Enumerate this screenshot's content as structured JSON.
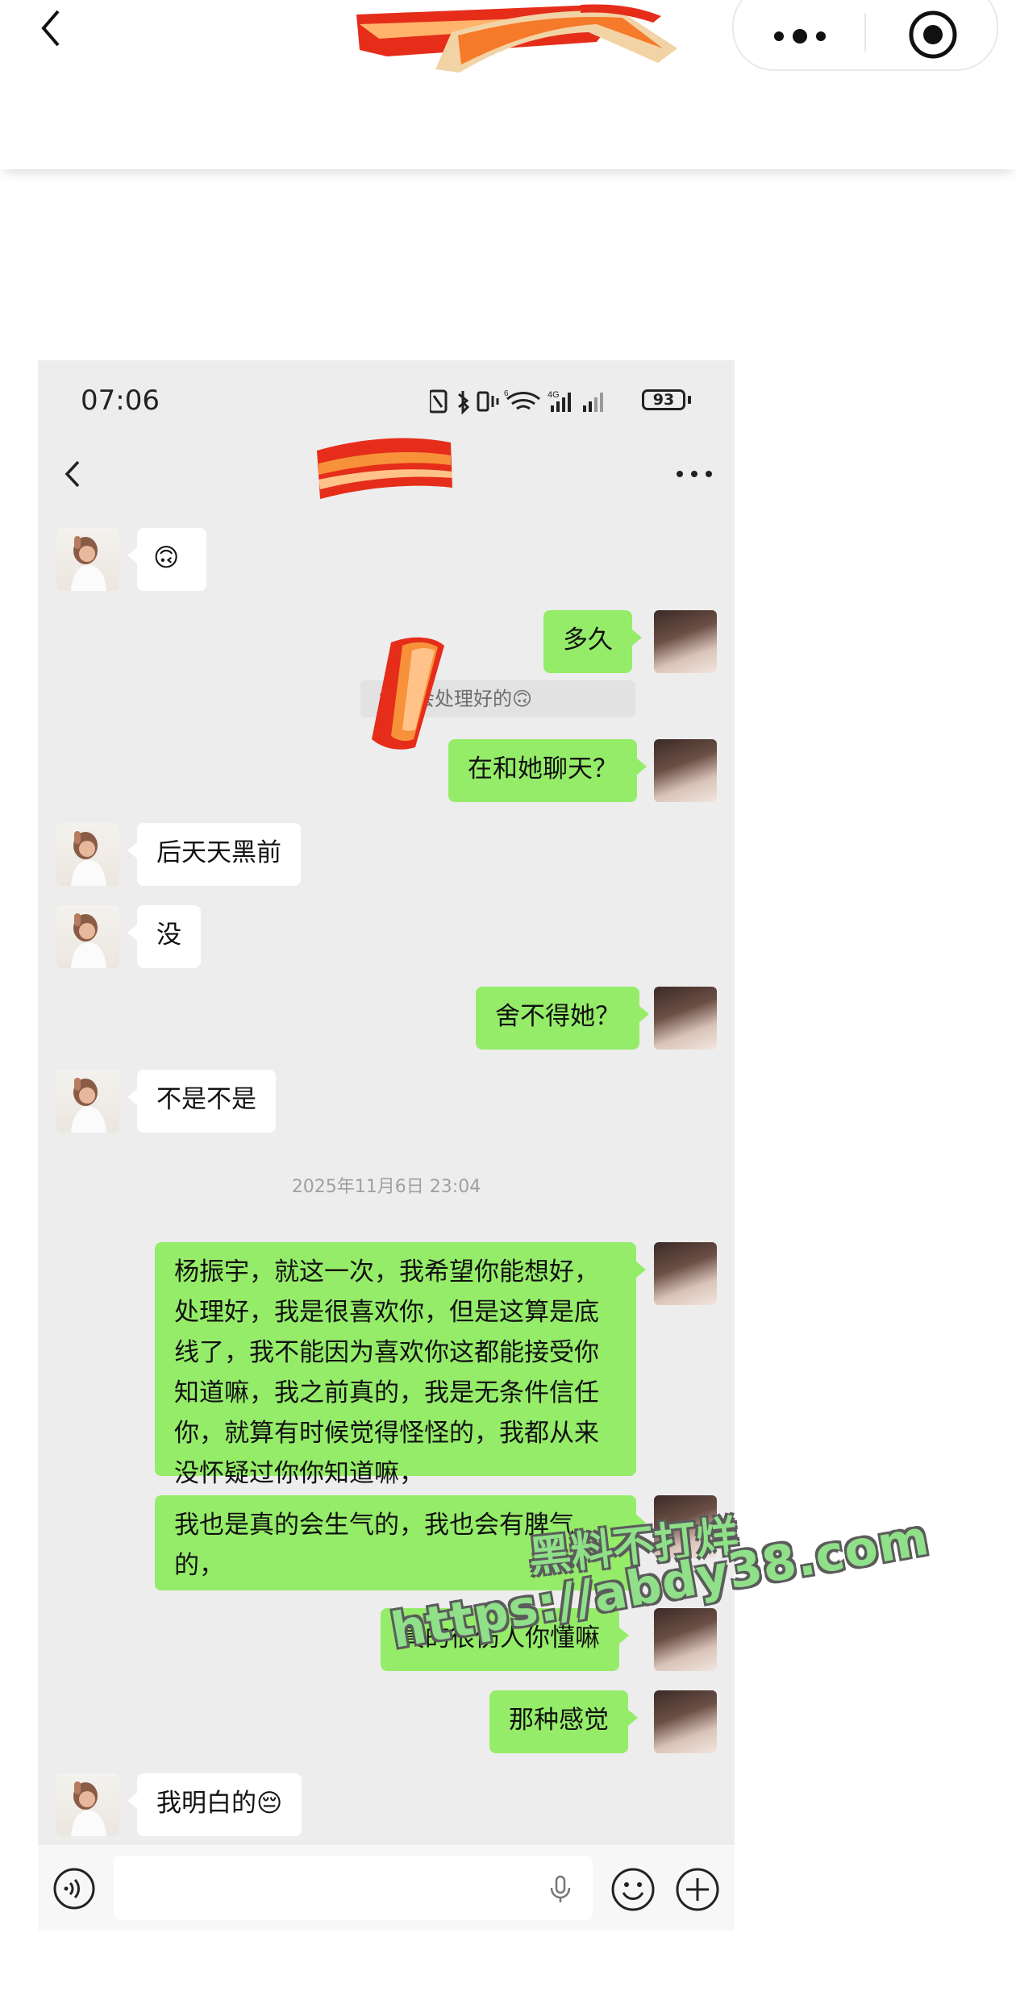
{
  "status_bar": {
    "time": "07:06",
    "battery": "93"
  },
  "timestamp": "2025年11月6日 23:04",
  "quote": {
    "text": "：我会处理好的🙃"
  },
  "messages": [
    {
      "side": "left",
      "text": "🙃"
    },
    {
      "side": "right",
      "text": "多久"
    },
    {
      "side": "right",
      "text": "在和她聊天？"
    },
    {
      "side": "left",
      "text": "后天天黑前"
    },
    {
      "side": "left",
      "text": "没"
    },
    {
      "side": "right",
      "text": "舍不得她？"
    },
    {
      "side": "left",
      "text": "不是不是"
    },
    {
      "side": "right",
      "text": "杨振宇，就这一次，我希望你能想好，处理好，我是很喜欢你，但是这算是底线了，我不能因为喜欢你这都能接受你知道嘛，我之前真的，我是无条件信任你，就算有时候觉得怪怪的，我都从来没怀疑过你你知道嘛，"
    },
    {
      "side": "right",
      "text": "我也是真的会生气的，我也会有脾气的，"
    },
    {
      "side": "right",
      "text": "真的很伤人你懂嘛"
    },
    {
      "side": "right",
      "text": "那种感觉"
    },
    {
      "side": "left",
      "text": "我明白的😔"
    }
  ],
  "watermark": {
    "line1": "黑料不打烊",
    "line2": "https://abdy38.com"
  },
  "colors": {
    "chat_bg": "#ededed",
    "bubble_self": "#95ec69",
    "bubble_other": "#ffffff"
  }
}
